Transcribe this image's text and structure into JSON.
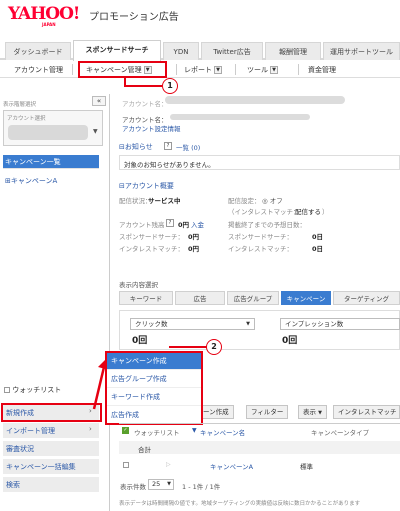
{
  "header": {
    "logo_text": "YAHOO!",
    "logo_sub": "JAPAN",
    "title": "プロモーション広告"
  },
  "main_tabs": [
    "ダッシュボード",
    "スポンサードサーチ",
    "YDN",
    "Twitter広告",
    "報酬管理",
    "運用サポートツール"
  ],
  "subnav": {
    "account": "アカウント管理",
    "campaign": "キャンペーン管理",
    "report": "レポート",
    "tools": "ツール",
    "funds": "資金管理"
  },
  "callouts": {
    "one": "1",
    "two": "2"
  },
  "sidebar": {
    "collapse_label": "«",
    "display_label": "表示階層選択",
    "account_select_label": "アカウント選択",
    "campaign_list": "キャンペーン一覧",
    "campaign_a": "⊞キャンペーンA",
    "watchlist": "ウォッチリスト",
    "new_create": "新規作成",
    "import": "インポート管理",
    "review": "審査状況",
    "bulk_edit": "キャンペーン一括編集",
    "search": "検索"
  },
  "account": {
    "name_label": "アカウント名：",
    "id_label": "アカウント名：",
    "settings_link": "アカウント設定情報",
    "notices_title": "⊟お知らせ",
    "notices_list_link": "一覧 (0)",
    "notices_empty": "対象のお知らせがありません。",
    "overview_title": "⊟アカウント概要",
    "status_label": "配信状況：",
    "status_value": "サービス中",
    "balance_label": "アカウント残高",
    "balance_value": "0円",
    "deposit_link": "入金",
    "sponsored_label": "スポンサードサーチ：",
    "sponsored_value": "0円",
    "interest_label": "インタレストマッチ：",
    "interest_value": "0円",
    "setting_label": "配信設定：",
    "setting_off": "◎ オフ",
    "interest_match_label": "（インタレストマッチ：",
    "interest_match_link": "配信する",
    "interest_match_tail": "）",
    "forecast_label": "掲載終了までの予想日数：",
    "sp_label": "スポンサードサーチ：",
    "sp_value": "0日",
    "im_label": "インタレストマッチ：",
    "im_value": "0日"
  },
  "content_tabs": {
    "label": "表示内容選択",
    "items": [
      "キーワード",
      "広告",
      "広告グループ",
      "キャンペーン",
      "ターゲティング"
    ]
  },
  "metrics": {
    "clicks_select": "クリック数",
    "clicks_value": "0回",
    "impressions_select": "インプレッション数",
    "impressions_value": "0回"
  },
  "menu": {
    "items": [
      "キャンペーン作成",
      "広告グループ作成",
      "キーワード作成",
      "広告作成"
    ]
  },
  "toolbar": {
    "create": "ーン作成",
    "filter": "フィルター",
    "display": "表示",
    "interest": "インタレストマッチ"
  },
  "table": {
    "headers": [
      "ウォッチリスト",
      "キャンペーン名",
      "キャンペーンタイプ"
    ],
    "total_label": "合計",
    "row_name": "キャンペーンA",
    "row_type": "標準",
    "page_size_label": "表示件数",
    "page_size": "25",
    "page_info": "1 - 1件 / 1件",
    "footnote": "表示データは時間間隔の値です。地域ターゲティングの実績値は反映に数日かかることがあります"
  }
}
